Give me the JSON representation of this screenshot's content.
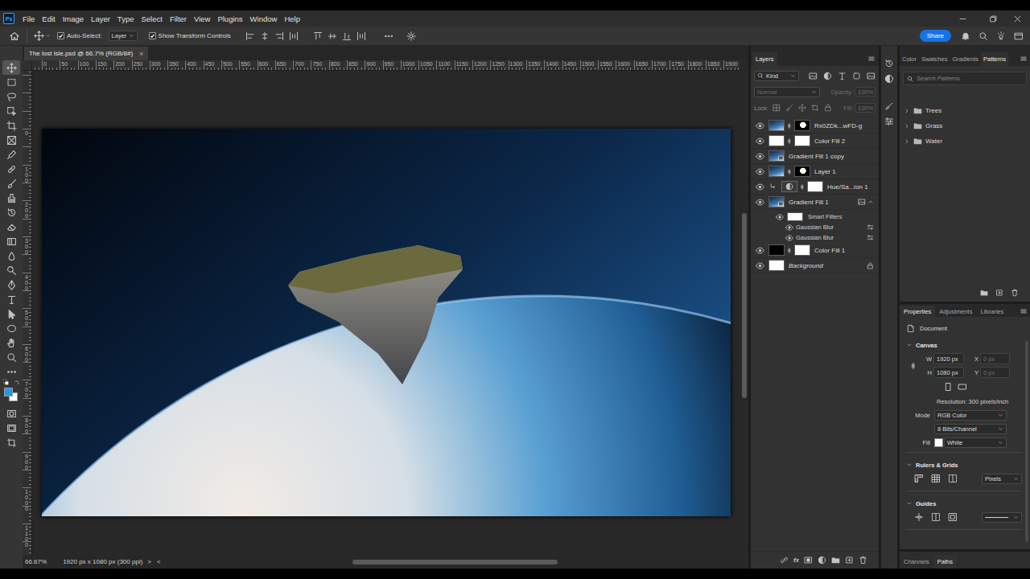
{
  "app": {
    "logo": "Ps"
  },
  "menu": [
    "File",
    "Edit",
    "Image",
    "Layer",
    "Type",
    "Select",
    "Filter",
    "View",
    "Plugins",
    "Window",
    "Help"
  ],
  "options_bar": {
    "auto_select": {
      "label": "Auto-Select:",
      "checked": true
    },
    "target": "Layer",
    "transform_controls": {
      "label": "Show Transform Controls",
      "checked": true
    },
    "share": "Share"
  },
  "document_tab": {
    "title": "The lost isle.psd @ 66.7% (RGB/8#)",
    "close": "×",
    "selected": true
  },
  "toolbar": {
    "tools": [
      {
        "kind": "move",
        "selected": true
      },
      {
        "kind": "marquee",
        "selected": false
      },
      {
        "kind": "lasso",
        "selected": false
      },
      {
        "kind": "objectselect",
        "selected": false
      },
      {
        "kind": "crop",
        "selected": false
      },
      {
        "kind": "frame",
        "selected": false
      },
      {
        "kind": "eyedropper",
        "selected": false
      },
      {
        "kind": "healing",
        "selected": false
      },
      {
        "kind": "brush",
        "selected": false
      },
      {
        "kind": "stamp",
        "selected": false
      },
      {
        "kind": "history",
        "selected": false
      },
      {
        "kind": "eraser",
        "selected": false
      },
      {
        "kind": "gradient",
        "selected": false
      },
      {
        "kind": "blur",
        "selected": false
      },
      {
        "kind": "dodge",
        "selected": false
      },
      {
        "kind": "pen",
        "selected": false
      },
      {
        "kind": "type",
        "selected": false
      },
      {
        "kind": "pathselect",
        "selected": false
      },
      {
        "kind": "ellipse",
        "selected": false
      },
      {
        "kind": "hand",
        "selected": false
      },
      {
        "kind": "zoom",
        "selected": false
      },
      {
        "kind": "more",
        "selected": false
      }
    ],
    "colors": {
      "foreground": "#1e9be6",
      "background": "#ffffff"
    },
    "modes": [
      {
        "kind": "quickmask"
      },
      {
        "kind": "screenmode"
      },
      {
        "kind": "artboard"
      }
    ]
  },
  "rulers": {
    "horizontal": [
      "0",
      "50",
      "100",
      "150",
      "200",
      "250",
      "300",
      "350",
      "400",
      "450",
      "500",
      "550",
      "600",
      "650",
      "700",
      "750",
      "800",
      "850",
      "900",
      "950",
      "1000",
      "1050",
      "1100",
      "1150",
      "1200",
      "1250",
      "1300",
      "1350",
      "1400",
      "1450",
      "1500",
      "1550",
      "1600",
      "1650",
      "1700",
      "1750",
      "1800",
      "1850",
      "1900"
    ],
    "vertical": [
      "0",
      "100",
      "200",
      "300",
      "400",
      "500",
      "600",
      "700",
      "800",
      "900",
      "1000",
      "1100"
    ]
  },
  "status_bar": {
    "zoom": "66.67%",
    "info": "1920 px x 1080 px (300 ppi)",
    "next": ">",
    "prev": "<"
  },
  "layers_panel": {
    "tab": {
      "label": "Layers",
      "selected": true
    },
    "filter": "Kind",
    "blend": {
      "value": "Normal",
      "disabled": true
    },
    "opacity": {
      "label": "Opacity:",
      "value": "100%",
      "disabled": true
    },
    "lock_label": "Lock:",
    "fill": {
      "label": "Fill:",
      "value": "100%",
      "disabled": true
    },
    "layers": [
      {
        "name": "Rx0ZDk...wFD-g",
        "visible": true,
        "selected": false,
        "kind": "pixel",
        "mask": true,
        "clipped": false,
        "locked": false
      },
      {
        "name": "Color Fill 2",
        "visible": true,
        "selected": false,
        "kind": "fill",
        "color": "#ffffff",
        "mask": true,
        "clipped": false,
        "locked": false
      },
      {
        "name": "Gradient Fill 1 copy",
        "visible": true,
        "selected": false,
        "kind": "smart",
        "mask": false,
        "clipped": false,
        "locked": false
      },
      {
        "name": "Layer 1",
        "visible": true,
        "selected": false,
        "kind": "pixel",
        "mask": true,
        "clipped": false,
        "locked": false
      },
      {
        "name": "Hue/Sa...ion 1",
        "visible": true,
        "selected": false,
        "kind": "adjustment",
        "mask": true,
        "clipped": true,
        "locked": false
      },
      {
        "name": "Gradient Fill 1",
        "visible": true,
        "selected": false,
        "kind": "smart",
        "mask": false,
        "clipped": false,
        "locked": false,
        "expanded": true,
        "smart_filters": {
          "label": "Smart Filters",
          "visible": true,
          "items": [
            {
              "name": "Gaussian Blur",
              "visible": true
            },
            {
              "name": "Gaussian Blur",
              "visible": true
            }
          ]
        }
      },
      {
        "name": "Color Fill 1",
        "visible": true,
        "selected": false,
        "kind": "fill",
        "color": "#000000",
        "mask": true,
        "clipped": false,
        "locked": false
      },
      {
        "name": "Background",
        "visible": true,
        "selected": false,
        "kind": "background",
        "mask": false,
        "clipped": false,
        "locked": true
      }
    ],
    "footer": {
      "fx": "fx"
    }
  },
  "patterns_panel": {
    "tabs": [
      {
        "label": "Color",
        "selected": false
      },
      {
        "label": "Swatches",
        "selected": false
      },
      {
        "label": "Gradients",
        "selected": false
      },
      {
        "label": "Patterns",
        "selected": true
      }
    ],
    "search": {
      "placeholder": "Search Patterns"
    },
    "folders": [
      {
        "name": "Trees",
        "expanded": false
      },
      {
        "name": "Grass",
        "expanded": false
      },
      {
        "name": "Water",
        "expanded": false
      }
    ]
  },
  "properties_panel": {
    "tabs": [
      {
        "label": "Properties",
        "selected": true
      },
      {
        "label": "Adjustments",
        "selected": false
      },
      {
        "label": "Libraries",
        "selected": false
      }
    ],
    "target": "Document",
    "canvas": {
      "title": "Canvas",
      "expanded": true,
      "fields": [
        {
          "label": "W",
          "value": "1920 px",
          "disabled": false
        },
        {
          "label": "X",
          "value": "0 px",
          "disabled": true
        },
        {
          "label": "H",
          "value": "1080 px",
          "disabled": false
        },
        {
          "label": "Y",
          "value": "0 px",
          "disabled": true
        }
      ],
      "resolution": "Resolution: 300 pixels/inch",
      "mode": {
        "label": "Mode",
        "value": "RGB Color"
      },
      "depth": "8 Bits/Channel",
      "fill": {
        "label": "Fill",
        "value": "White"
      }
    },
    "rulers_grids": {
      "title": "Rulers & Grids",
      "expanded": true,
      "units": "Pixels"
    },
    "guides": {
      "title": "Guides",
      "expanded": true
    }
  },
  "bottom_panel": {
    "tabs": [
      {
        "label": "Channels",
        "selected": false
      },
      {
        "label": "Paths",
        "selected": true
      }
    ]
  }
}
